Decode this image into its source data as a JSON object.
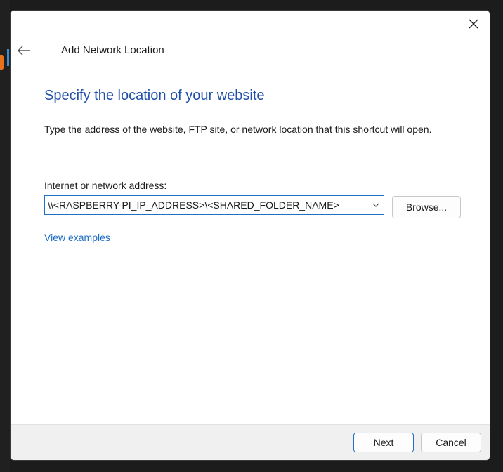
{
  "window": {
    "title": "Add Network Location",
    "close_icon": "close-icon",
    "back_icon": "back-arrow-icon"
  },
  "page": {
    "heading": "Specify the location of your website",
    "description": "Type the address of the website, FTP site, or network location that this shortcut will open."
  },
  "address": {
    "label": "Internet or network address:",
    "value": "\\\\<RASPBERRY-PI_IP_ADDRESS>\\<SHARED_FOLDER_NAME>",
    "dropdown_icon": "chevron-down-icon"
  },
  "buttons": {
    "browse": "Browse...",
    "next": "Next",
    "cancel": "Cancel"
  },
  "links": {
    "view_examples": "View examples"
  },
  "colors": {
    "heading": "#1f4fa8",
    "accent": "#1f6fc4",
    "footer_bg": "#f0f0f0"
  }
}
